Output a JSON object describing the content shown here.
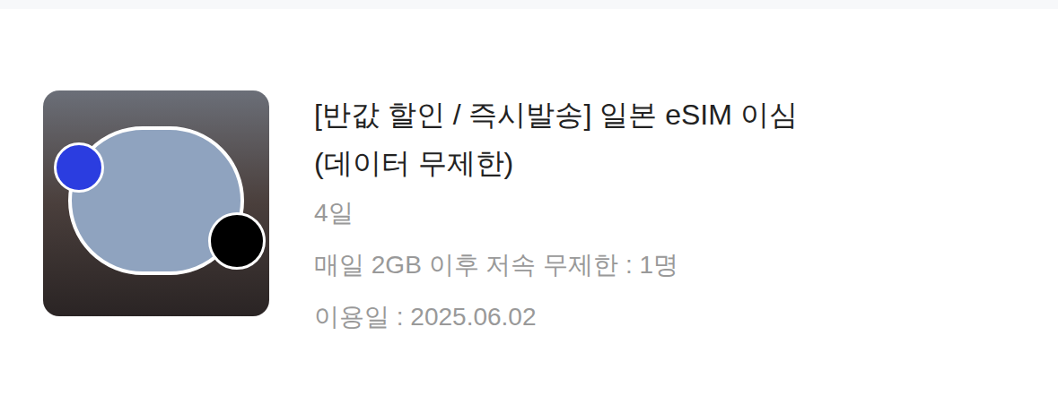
{
  "product": {
    "title_lines": [
      "[반값 할인 / 즉시발송] 일본 eSIM 이심",
      "(데이터 무제한)"
    ],
    "details": [
      "4일",
      "매일 2GB 이후 저속 무제한 : 1명",
      "이용일 : 2025.06.02"
    ]
  }
}
